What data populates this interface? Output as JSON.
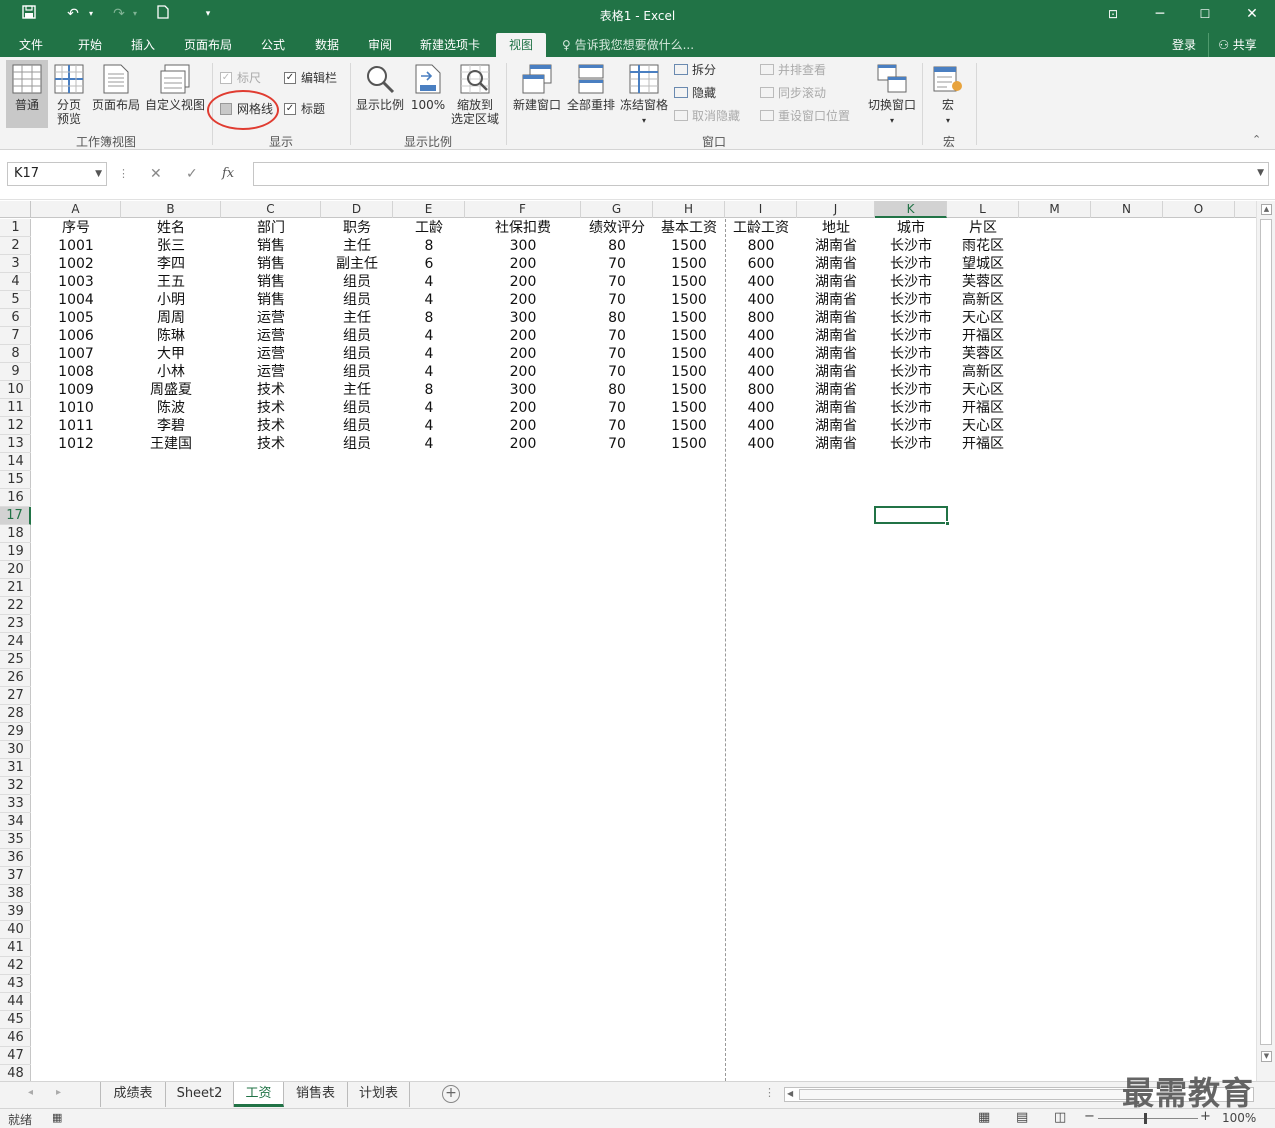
{
  "window": {
    "title": "表格1 - Excel"
  },
  "tabs": [
    "文件",
    "开始",
    "插入",
    "页面布局",
    "公式",
    "数据",
    "审阅",
    "新建选项卡",
    "视图"
  ],
  "active_tab": "视图",
  "tell_me": "告诉我您想要做什么...",
  "account": {
    "login": "登录",
    "share": "共享"
  },
  "ribbon": {
    "workbook_views": {
      "label": "工作簿视图",
      "normal": "普通",
      "page_break_1": "分页",
      "page_break_2": "预览",
      "page_layout": "页面布局",
      "custom_views": "自定义视图"
    },
    "show": {
      "label": "显示",
      "ruler": "标尺",
      "formula_bar": "编辑栏",
      "gridlines": "网格线",
      "headings": "标题"
    },
    "zoom": {
      "label": "显示比例",
      "zoom": "显示比例",
      "hundred": "100%",
      "zoom_sel_1": "缩放到",
      "zoom_sel_2": "选定区域"
    },
    "window": {
      "label": "窗口",
      "new_window": "新建窗口",
      "arrange_all": "全部重排",
      "freeze": "冻结窗格",
      "split": "拆分",
      "hide": "隐藏",
      "unhide": "取消隐藏",
      "side_by_side": "并排查看",
      "sync_scroll": "同步滚动",
      "reset_pos": "重设窗口位置",
      "switch": "切换窗口"
    },
    "macros": {
      "label": "宏",
      "macros": "宏"
    }
  },
  "formula_bar": {
    "name_box": "K17",
    "fx": "fx",
    "value": ""
  },
  "columns": [
    "A",
    "B",
    "C",
    "D",
    "E",
    "F",
    "G",
    "H",
    "I",
    "J",
    "K",
    "L",
    "M",
    "N",
    "O"
  ],
  "selected_column": "K",
  "selected_row": 17,
  "rows": [
    [
      "序号",
      "姓名",
      "部门",
      "职务",
      "工龄",
      "社保扣费",
      "绩效评分",
      "基本工资",
      "工龄工资",
      "地址",
      "城市",
      "片区"
    ],
    [
      "1001",
      "张三",
      "销售",
      "主任",
      "8",
      "300",
      "80",
      "1500",
      "800",
      "湖南省",
      "长沙市",
      "雨花区"
    ],
    [
      "1002",
      "李四",
      "销售",
      "副主任",
      "6",
      "200",
      "70",
      "1500",
      "600",
      "湖南省",
      "长沙市",
      "望城区"
    ],
    [
      "1003",
      "王五",
      "销售",
      "组员",
      "4",
      "200",
      "70",
      "1500",
      "400",
      "湖南省",
      "长沙市",
      "芙蓉区"
    ],
    [
      "1004",
      "小明",
      "销售",
      "组员",
      "4",
      "200",
      "70",
      "1500",
      "400",
      "湖南省",
      "长沙市",
      "高新区"
    ],
    [
      "1005",
      "周周",
      "运营",
      "主任",
      "8",
      "300",
      "80",
      "1500",
      "800",
      "湖南省",
      "长沙市",
      "天心区"
    ],
    [
      "1006",
      "陈琳",
      "运营",
      "组员",
      "4",
      "200",
      "70",
      "1500",
      "400",
      "湖南省",
      "长沙市",
      "开福区"
    ],
    [
      "1007",
      "大甲",
      "运营",
      "组员",
      "4",
      "200",
      "70",
      "1500",
      "400",
      "湖南省",
      "长沙市",
      "芙蓉区"
    ],
    [
      "1008",
      "小林",
      "运营",
      "组员",
      "4",
      "200",
      "70",
      "1500",
      "400",
      "湖南省",
      "长沙市",
      "高新区"
    ],
    [
      "1009",
      "周盛夏",
      "技术",
      "主任",
      "8",
      "300",
      "80",
      "1500",
      "800",
      "湖南省",
      "长沙市",
      "天心区"
    ],
    [
      "1010",
      "陈波",
      "技术",
      "组员",
      "4",
      "200",
      "70",
      "1500",
      "400",
      "湖南省",
      "长沙市",
      "开福区"
    ],
    [
      "1011",
      "李碧",
      "技术",
      "组员",
      "4",
      "200",
      "70",
      "1500",
      "400",
      "湖南省",
      "长沙市",
      "天心区"
    ],
    [
      "1012",
      "王建国",
      "技术",
      "组员",
      "4",
      "200",
      "70",
      "1500",
      "400",
      "湖南省",
      "长沙市",
      "开福区"
    ]
  ],
  "row_count": 48,
  "sheets": [
    "成绩表",
    "Sheet2",
    "工资",
    "销售表",
    "计划表"
  ],
  "active_sheet": "工资",
  "status": {
    "ready": "就绪",
    "zoom": "100%"
  },
  "watermark": "最需教育",
  "colors": {
    "excel_green": "#217346",
    "highlight_circle": "#e03c31"
  }
}
